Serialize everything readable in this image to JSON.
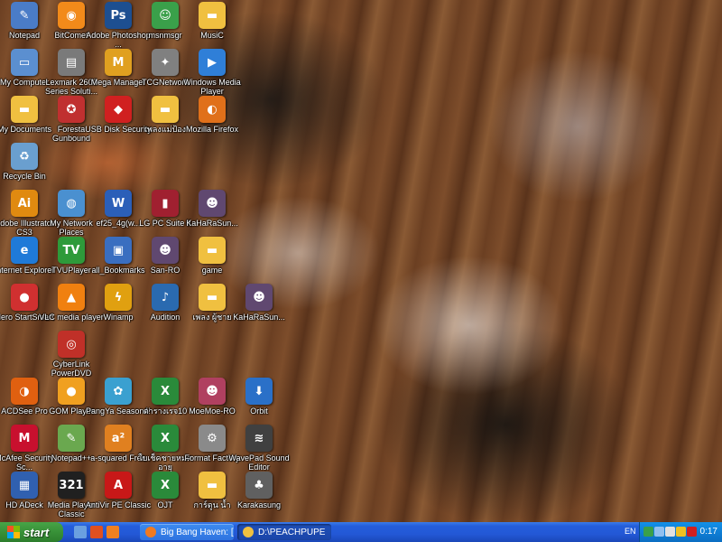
{
  "desktop": {
    "icons": [
      {
        "label": "Notepad",
        "col": 0,
        "row": 0,
        "icon": "notepad-icon",
        "glyph": "✎",
        "color": "#4a7cc7"
      },
      {
        "label": "BitComet",
        "col": 1,
        "row": 0,
        "icon": "bitcomet-icon",
        "glyph": "◉",
        "color": "#f28a1a"
      },
      {
        "label": "Adobe Photoshop ...",
        "col": 2,
        "row": 0,
        "icon": "photoshop-icon",
        "glyph": "Ps",
        "color": "#1d4f91"
      },
      {
        "label": "msnmsgr",
        "col": 3,
        "row": 0,
        "icon": "msn-icon",
        "glyph": "☺",
        "color": "#3aa04a"
      },
      {
        "label": "MusiC",
        "col": 4,
        "row": 0,
        "icon": "folder-icon",
        "glyph": "▬",
        "color": "#f0c040"
      },
      {
        "label": "My Computer",
        "col": 0,
        "row": 1,
        "icon": "computer-icon",
        "glyph": "▭",
        "color": "#5b8fd0"
      },
      {
        "label": "Lexmark 2600 Series Soluti...",
        "col": 1,
        "row": 1,
        "icon": "printer-icon",
        "glyph": "▤",
        "color": "#7a7a7a"
      },
      {
        "label": "Mega Manager",
        "col": 2,
        "row": 1,
        "icon": "mega-manager-icon",
        "glyph": "M",
        "color": "#e0a020"
      },
      {
        "label": "TCGNetwork",
        "col": 3,
        "row": 1,
        "icon": "tcg-network-icon",
        "glyph": "✦",
        "color": "#808080"
      },
      {
        "label": "Windows Media Player",
        "col": 4,
        "row": 1,
        "icon": "media-player-icon",
        "glyph": "▶",
        "color": "#2f7fd8"
      },
      {
        "label": "My Documents",
        "col": 0,
        "row": 2,
        "icon": "documents-folder-icon",
        "glyph": "▬",
        "color": "#f0c040"
      },
      {
        "label": "Foresta Gunbound",
        "col": 1,
        "row": 2,
        "icon": "gunbound-icon",
        "glyph": "✪",
        "color": "#c03030"
      },
      {
        "label": "USB Disk Security",
        "col": 2,
        "row": 2,
        "icon": "usb-security-icon",
        "glyph": "◆",
        "color": "#d02020"
      },
      {
        "label": "เพลงแม่ป้อง",
        "col": 3,
        "row": 2,
        "icon": "folder-icon",
        "glyph": "▬",
        "color": "#f0c040"
      },
      {
        "label": "Mozilla Firefox",
        "col": 4,
        "row": 2,
        "icon": "firefox-icon",
        "glyph": "◐",
        "color": "#e0701a"
      },
      {
        "label": "Recycle Bin",
        "col": 0,
        "row": 3,
        "icon": "recycle-bin-icon",
        "glyph": "♻",
        "color": "#6a9fcf"
      },
      {
        "label": "Adobe Illustrator CS3",
        "col": 0,
        "row": 4,
        "icon": "illustrator-icon",
        "glyph": "Ai",
        "color": "#e08a10"
      },
      {
        "label": "My Network Places",
        "col": 1,
        "row": 4,
        "icon": "network-places-icon",
        "glyph": "◍",
        "color": "#4a90d0"
      },
      {
        "label": "ef25_4g(w...",
        "col": 2,
        "row": 4,
        "icon": "word-document-icon",
        "glyph": "W",
        "color": "#2b5fb8"
      },
      {
        "label": "LG PC Suite II",
        "col": 3,
        "row": 4,
        "icon": "lg-pc-suite-icon",
        "glyph": "▮",
        "color": "#a02030"
      },
      {
        "label": "KaHaRaSun...",
        "col": 4,
        "row": 4,
        "icon": "anime-image-icon",
        "glyph": "☻",
        "color": "#604870"
      },
      {
        "label": "Internet Explorer",
        "col": 0,
        "row": 5,
        "icon": "internet-explorer-icon",
        "glyph": "e",
        "color": "#1f7ad8"
      },
      {
        "label": "TVUPlayer",
        "col": 1,
        "row": 5,
        "icon": "tvu-player-icon",
        "glyph": "TV",
        "color": "#2e9a3a"
      },
      {
        "label": "all_Bookmarks",
        "col": 2,
        "row": 5,
        "icon": "pdf-document-icon",
        "glyph": "▣",
        "color": "#3a6ec0"
      },
      {
        "label": "San-RO",
        "col": 3,
        "row": 5,
        "icon": "anime-image-icon",
        "glyph": "☻",
        "color": "#604870"
      },
      {
        "label": "game",
        "col": 4,
        "row": 5,
        "icon": "folder-icon",
        "glyph": "▬",
        "color": "#f0c040"
      },
      {
        "label": "Nero StartSmart",
        "col": 0,
        "row": 6,
        "icon": "nero-icon",
        "glyph": "●",
        "color": "#d03030"
      },
      {
        "label": "VLC media player",
        "col": 1,
        "row": 6,
        "icon": "vlc-icon",
        "glyph": "▲",
        "color": "#f08010"
      },
      {
        "label": "Winamp",
        "col": 2,
        "row": 6,
        "icon": "winamp-icon",
        "glyph": "ϟ",
        "color": "#e0a010"
      },
      {
        "label": "Audition",
        "col": 3,
        "row": 6,
        "icon": "audition-icon",
        "glyph": "♪",
        "color": "#2a6ab0"
      },
      {
        "label": "เพลง ผู้ชาย",
        "col": 4,
        "row": 6,
        "icon": "folder-icon",
        "glyph": "▬",
        "color": "#f0c040"
      },
      {
        "label": "KaHaRaSun...",
        "col": 5,
        "row": 6,
        "icon": "anime-image-icon",
        "glyph": "☻",
        "color": "#604870"
      },
      {
        "label": "CyberLink PowerDVD",
        "col": 1,
        "row": 7,
        "icon": "powerdvd-icon",
        "glyph": "◎",
        "color": "#c03028"
      },
      {
        "label": "ACDSee Pro",
        "col": 0,
        "row": 8,
        "icon": "acdsee-icon",
        "glyph": "◑",
        "color": "#e06010"
      },
      {
        "label": "GOM Player",
        "col": 1,
        "row": 8,
        "icon": "gom-player-icon",
        "glyph": "●",
        "color": "#f0a020"
      },
      {
        "label": "PangYa Season4!",
        "col": 2,
        "row": 8,
        "icon": "pangya-icon",
        "glyph": "✿",
        "color": "#3aa0d0"
      },
      {
        "label": "ตารางเรจ10",
        "col": 3,
        "row": 8,
        "icon": "excel-document-icon",
        "glyph": "X",
        "color": "#2a8a3a"
      },
      {
        "label": "MoeMoe-RO",
        "col": 4,
        "row": 8,
        "icon": "anime-image-icon",
        "glyph": "☻",
        "color": "#b04060"
      },
      {
        "label": "Orbit",
        "col": 5,
        "row": 8,
        "icon": "orbit-icon",
        "glyph": "⬇",
        "color": "#2a70c8"
      },
      {
        "label": "McAfee Security Sc...",
        "col": 0,
        "row": 9,
        "icon": "mcafee-icon",
        "glyph": "M",
        "color": "#c8102e"
      },
      {
        "label": "Notepad++",
        "col": 1,
        "row": 9,
        "icon": "notepadpp-icon",
        "glyph": "✎",
        "color": "#6aa84f"
      },
      {
        "label": "a-squared Free",
        "col": 2,
        "row": 9,
        "icon": "a-squared-icon",
        "glyph": "a²",
        "color": "#e08020"
      },
      {
        "label": "ใบเช็คชายหมด อายุ",
        "col": 3,
        "row": 9,
        "icon": "excel-document-icon",
        "glyph": "X",
        "color": "#2a8a3a"
      },
      {
        "label": "Format Factory",
        "col": 4,
        "row": 9,
        "icon": "format-factory-icon",
        "glyph": "⚙",
        "color": "#8a8a8a"
      },
      {
        "label": "WavePad Sound Editor",
        "col": 5,
        "row": 9,
        "icon": "wavepad-icon",
        "glyph": "≋",
        "color": "#404040"
      },
      {
        "label": "HD ADeck",
        "col": 0,
        "row": 10,
        "icon": "hd-adeck-icon",
        "glyph": "▦",
        "color": "#3060b0"
      },
      {
        "label": "Media Player Classic",
        "col": 1,
        "row": 10,
        "icon": "media-player-classic-icon",
        "glyph": "321",
        "color": "#202020"
      },
      {
        "label": "AntiVir PE Classic",
        "col": 2,
        "row": 10,
        "icon": "antivir-icon",
        "glyph": "A",
        "color": "#c81818"
      },
      {
        "label": "OJT",
        "col": 3,
        "row": 10,
        "icon": "excel-document-icon",
        "glyph": "X",
        "color": "#2a8a3a"
      },
      {
        "label": "การ์ตูน น้ำ",
        "col": 4,
        "row": 10,
        "icon": "folder-icon",
        "glyph": "▬",
        "color": "#f0c040"
      },
      {
        "label": "Karakasung",
        "col": 5,
        "row": 10,
        "icon": "karakasung-icon",
        "glyph": "♣",
        "color": "#606060"
      }
    ]
  },
  "taskbar": {
    "start_label": "start",
    "quick_launch": [
      {
        "icon": "show-desktop-icon",
        "color": "#6aa0e0"
      },
      {
        "icon": "media-player-quicklaunch-icon",
        "color": "#e05020"
      },
      {
        "icon": "firefox-quicklaunch-icon",
        "color": "#f08020"
      }
    ],
    "tasks": [
      {
        "label": "Big Bang Haven: [Pics...",
        "icon": "firefox-task-icon",
        "color": "#f07a20",
        "active": false
      },
      {
        "label": "D:\\PEACHPUPE",
        "icon": "folder-task-icon",
        "color": "#f0c040",
        "active": true
      }
    ],
    "tray": {
      "language": "EN",
      "icons": [
        {
          "icon": "msn-tray-icon",
          "color": "#3aa04a"
        },
        {
          "icon": "network-tray-icon",
          "color": "#90c0f0"
        },
        {
          "icon": "volume-tray-icon",
          "color": "#e0e0e0"
        },
        {
          "icon": "security-tray-icon",
          "color": "#f0c020"
        },
        {
          "icon": "antivir-tray-icon",
          "color": "#d02020"
        }
      ],
      "clock": "0:17"
    }
  }
}
